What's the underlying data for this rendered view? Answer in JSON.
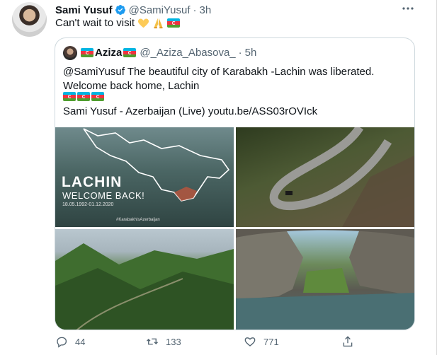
{
  "tweet": {
    "author_name": "Sami Yusuf",
    "author_handle": "@SamiYusuf",
    "time": "3h",
    "text": "Can't wait to visit",
    "text_emojis": [
      "yellow-heart",
      "folded-hands",
      "azerbaijan-flag"
    ]
  },
  "quote": {
    "author_name": "Aziza",
    "author_handle": "@_Aziza_Abasova_",
    "time": "5h",
    "text_line1": "@SamiYusuf The  beautiful city of Karabakh -Lachin was liberated.",
    "text_line2": "Welcome back home, Lachin",
    "link_line": "Sami Yusuf - Azerbaijan (Live) youtu.be/ASS03rOVIck",
    "media": {
      "poster_title": "LACHIN",
      "poster_subtitle": "WELCOME BACK!",
      "poster_dates": "18.05.1992-01.12.2020",
      "poster_hashtag": "#KarabakhisAzerbaijan"
    }
  },
  "actions": {
    "replies": "44",
    "retweets": "133",
    "likes": "771"
  },
  "colors": {
    "verified": "#1d9bf0",
    "secondary_text": "#536471",
    "border": "#cfd9de"
  }
}
